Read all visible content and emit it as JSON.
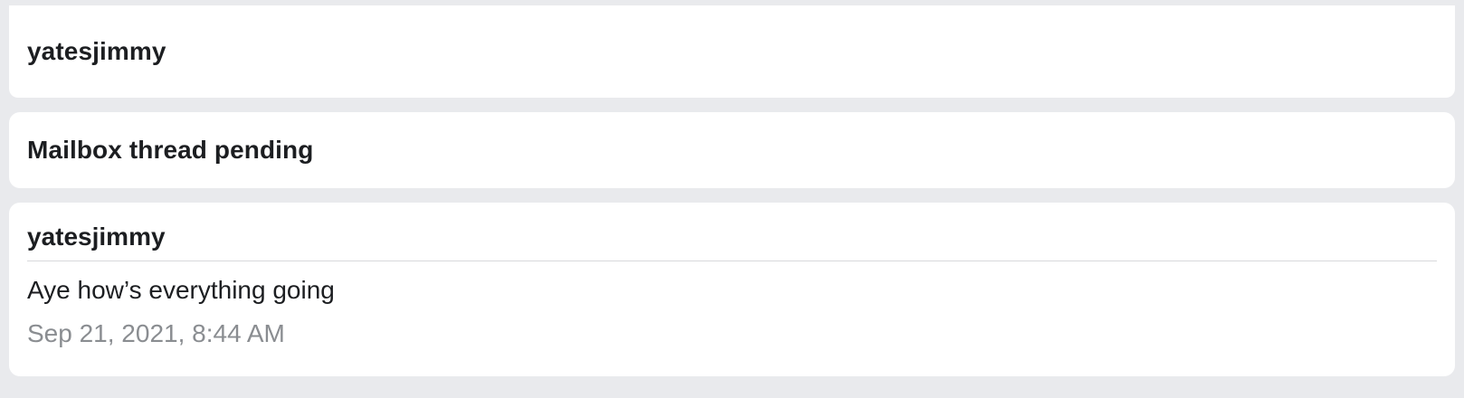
{
  "thread": {
    "participant_name": "yatesjimmy",
    "status_text": "Mailbox thread pending"
  },
  "message": {
    "author": "yatesjimmy",
    "body": "Aye how’s everything going",
    "timestamp": "Sep 21, 2021, 8:44 AM"
  },
  "colors": {
    "background": "#e9eaed",
    "card": "#ffffff",
    "text": "#1c1e21",
    "muted_text": "#8a8d91",
    "divider": "#d8d9dc"
  }
}
